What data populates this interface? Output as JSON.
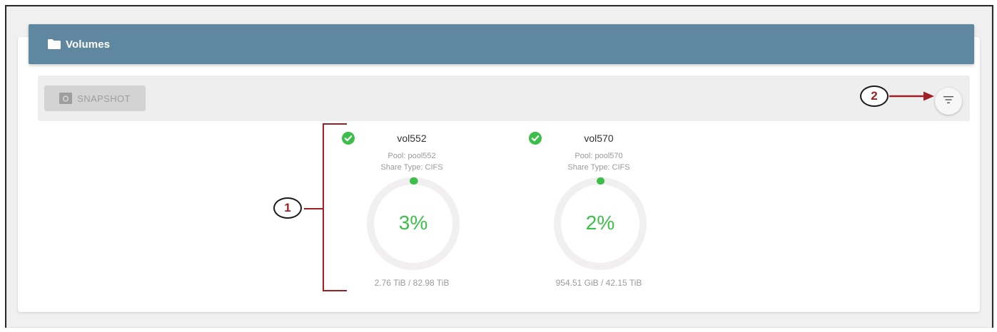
{
  "header": {
    "title": "Volumes",
    "icon": "folder-icon"
  },
  "toolbar": {
    "snapshot_label": "SNAPSHOT",
    "snapshot_icon": "camera-icon",
    "filter_icon": "filter-icon"
  },
  "volumes": [
    {
      "name": "vol552",
      "pool": "Pool: pool552",
      "share_type": "Share Type: CIFS",
      "percent": "3%",
      "percent_value": 3,
      "usage": "2.76 TiB / 82.98 TiB",
      "status_icon": "check-circle-icon"
    },
    {
      "name": "vol570",
      "pool": "Pool: pool570",
      "share_type": "Share Type: CIFS",
      "percent": "2%",
      "percent_value": 2,
      "usage": "954.51 GiB / 42.15 TiB",
      "status_icon": "check-circle-icon"
    }
  ],
  "annotations": [
    {
      "label": "1"
    },
    {
      "label": "2"
    }
  ],
  "colors": {
    "header_bg": "#5f88a0",
    "status_green": "#3cbf4a",
    "annotation_red": "#a01f24",
    "gauge_track": "#f1efef"
  }
}
